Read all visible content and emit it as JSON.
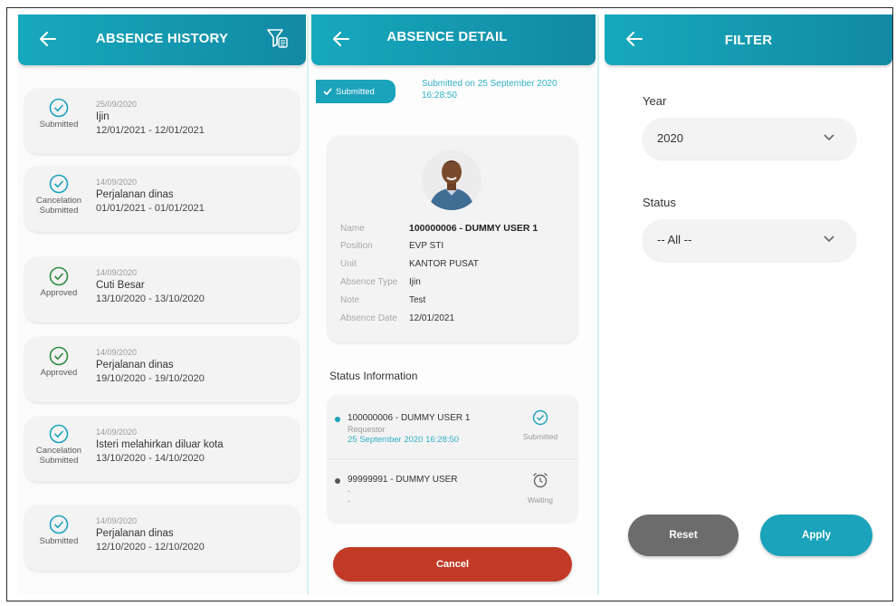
{
  "history": {
    "title": "ABSENCE HISTORY",
    "back_icon": "arrow-left-icon",
    "filter_icon": "filter-icon",
    "items": [
      {
        "status": "Submitted",
        "date": "25/09/2020",
        "type": "Ijin",
        "range": "12/01/2021 - 12/01/2021",
        "icon": "check-circle-icon",
        "color": "#1aa3bb"
      },
      {
        "status": "Cancelation Submitted",
        "date": "14/09/2020",
        "type": "Perjalanan dinas",
        "range": "01/01/2021 - 01/01/2021",
        "icon": "check-circle-icon",
        "color": "#1aa3bb"
      },
      {
        "status": "Approved",
        "date": "14/09/2020",
        "type": "Cuti Besar",
        "range": "13/10/2020 - 13/10/2020",
        "icon": "check-circle-icon",
        "color": "#2e8b3e"
      },
      {
        "status": "Approved",
        "date": "14/09/2020",
        "type": "Perjalanan dinas",
        "range": "19/10/2020 - 19/10/2020",
        "icon": "check-circle-icon",
        "color": "#2e8b3e"
      },
      {
        "status": "Cancelation Submitted",
        "date": "14/09/2020",
        "type": "Isteri melahirkan diluar kota",
        "range": "13/10/2020 - 14/10/2020",
        "icon": "check-circle-icon",
        "color": "#1aa3bb"
      },
      {
        "status": "Submitted",
        "date": "14/09/2020",
        "type": "Perjalanan dinas",
        "range": "12/10/2020 - 12/10/2020",
        "icon": "check-circle-icon",
        "color": "#1aa3bb"
      }
    ]
  },
  "detail": {
    "title": "ABSENCE DETAIL",
    "badge": "Submitted",
    "submitted_on": "Submitted on 25 September 2020 16:28:50",
    "avatar_icon": "user-avatar-icon",
    "fields": [
      {
        "label": "Name",
        "value": "100000006 - DUMMY USER 1"
      },
      {
        "label": "Position",
        "value": "EVP STI"
      },
      {
        "label": "Unit",
        "value": "KANTOR PUSAT"
      },
      {
        "label": "Absence Type",
        "value": "Ijin"
      },
      {
        "label": "Note",
        "value": "Test"
      },
      {
        "label": "Absence Date",
        "value": "12/01/2021"
      }
    ],
    "status_title": "Status Information",
    "statuses": [
      {
        "name": "100000006 - DUMMY USER 1",
        "role": "Requestor",
        "time": "25 September 2020 16:28:50",
        "state": "Submitted",
        "icon": "check-circle-icon",
        "dot_color": "#1aa3bb"
      },
      {
        "name": "99999991 - DUMMY USER",
        "role": "-",
        "time": "-",
        "state": "Waiting",
        "icon": "alarm-clock-icon",
        "dot_color": "#555555"
      }
    ],
    "cancel_label": "Cancel"
  },
  "filter": {
    "title": "FILTER",
    "year_label": "Year",
    "year_value": "2020",
    "status_label": "Status",
    "status_value": "-- All --",
    "reset_label": "Reset",
    "apply_label": "Apply"
  }
}
